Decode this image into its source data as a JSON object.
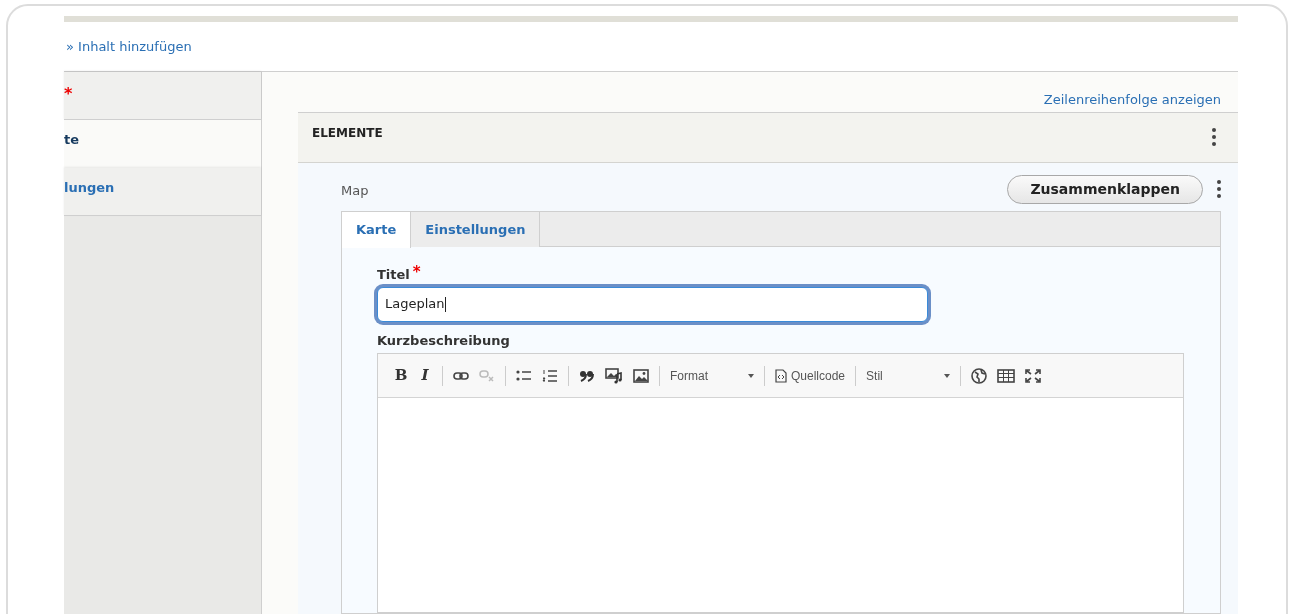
{
  "breadcrumb": "» Inhalt hinzufügen",
  "sidebar": {
    "items": [
      {
        "label": "*",
        "kind": "required-mark",
        "selected": false
      },
      {
        "label": "te",
        "kind": "link",
        "selected": true
      },
      {
        "label": "lungen",
        "kind": "link",
        "selected": false
      }
    ]
  },
  "row_order_link": "Zeilenreihenfolge anzeigen",
  "section": {
    "title": "ELEMENTE"
  },
  "paragraph": {
    "label": "Map",
    "collapse_button": "Zusammenklappen",
    "tabs": [
      {
        "label": "Karte",
        "selected": true
      },
      {
        "label": "Einstellungen",
        "selected": false
      }
    ],
    "title_field": {
      "label": "Titel",
      "required_mark": "*",
      "value": "Lageplan",
      "focused": true
    },
    "description_label": "Kurzbeschreibung",
    "toolbar": {
      "bold": "B",
      "italic": "I",
      "format_dropdown": "Format",
      "source_button": "Quellcode",
      "style_dropdown": "Stil"
    }
  }
}
